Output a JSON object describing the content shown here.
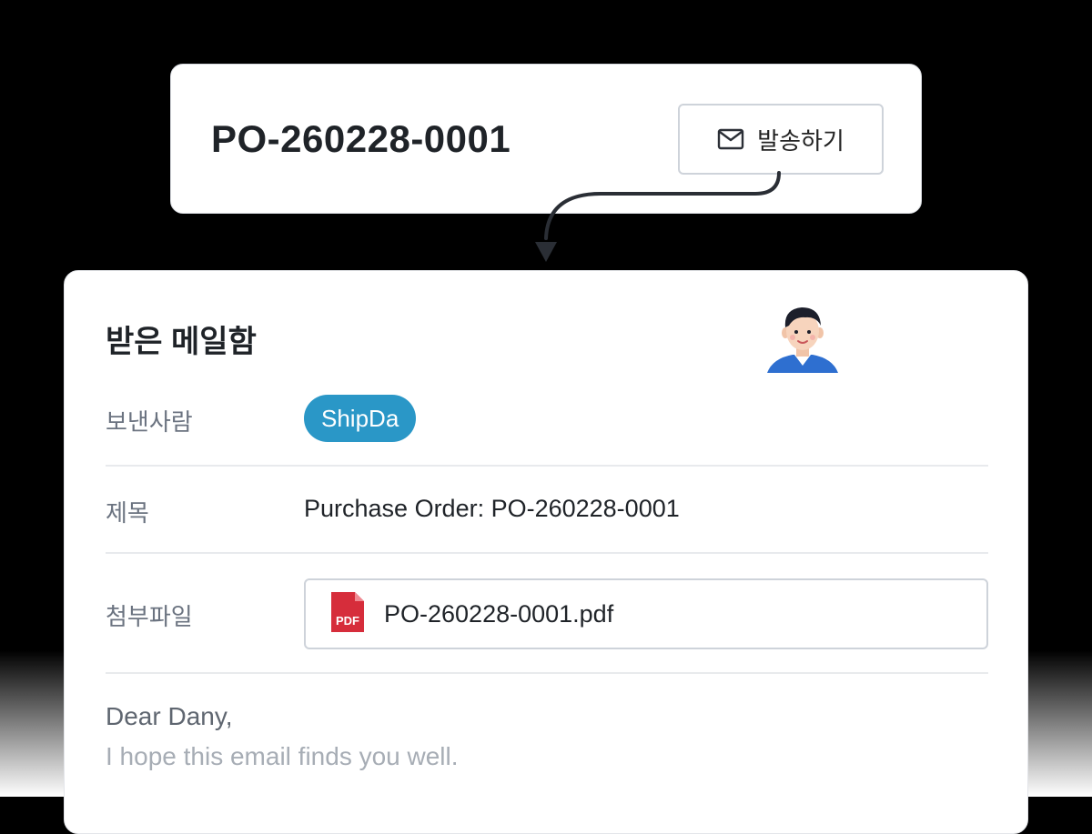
{
  "po_card": {
    "po_number": "PO-260228-0001",
    "send_button": {
      "label": "발송하기",
      "icon": "mail-icon"
    }
  },
  "mail": {
    "title": "받은 메일함",
    "avatar": "person-avatar",
    "fields": {
      "sender_label": "보낸사람",
      "sender_value": "ShipDa",
      "subject_label": "제목",
      "subject_value": "Purchase Order: PO-260228-0001",
      "attachment_label": "첨부파일",
      "attachment_name": "PO-260228-0001.pdf",
      "attachment_icon": "pdf-file-icon",
      "attachment_icon_text": "PDF"
    },
    "body": {
      "greeting": "Dear Dany,",
      "line2": "I hope this email finds you well."
    }
  },
  "colors": {
    "chip_blue": "#2a97c7",
    "pdf_red": "#d62d3b",
    "avatar_shirt": "#2e6fd0"
  }
}
